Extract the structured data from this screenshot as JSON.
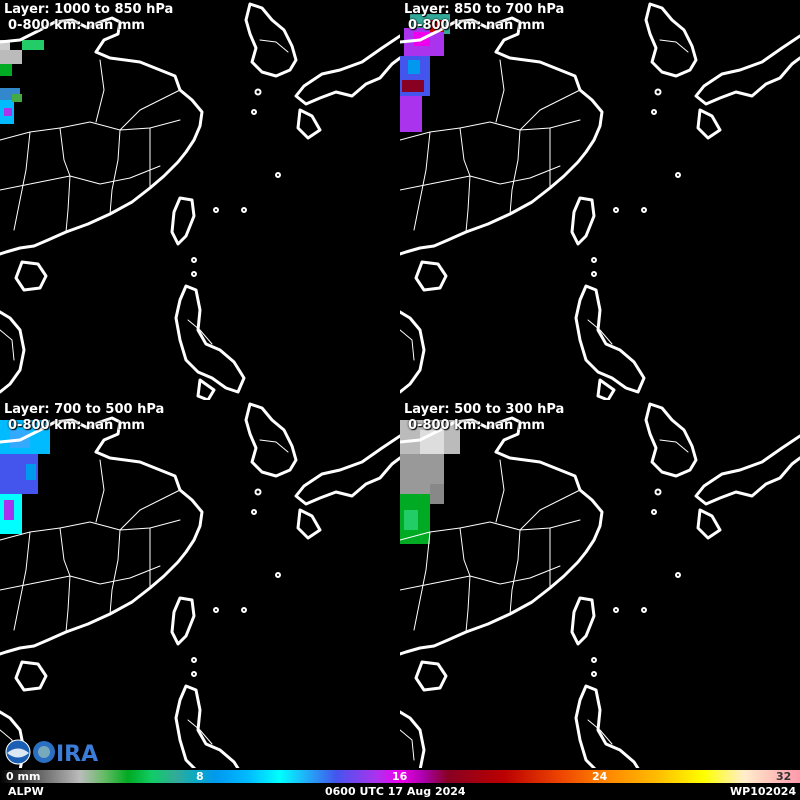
{
  "panels": [
    {
      "layer": "Layer: 1000 to 850 hPa",
      "range": "0-800 km: nan mm"
    },
    {
      "layer": "Layer: 850 to 700 hPa",
      "range": "0-800 km: nan mm"
    },
    {
      "layer": "Layer: 700 to 500 hPa",
      "range": "0-800 km: nan mm"
    },
    {
      "layer": "Layer: 500 to 300 hPa",
      "range": "0-800 km: nan mm"
    }
  ],
  "colorbar": {
    "ticks": [
      "0 mm",
      "8",
      "16",
      "24",
      "32"
    ]
  },
  "footer": {
    "product": "ALPW",
    "time": "0600 UTC 17 Aug 2024",
    "storm_id": "WP102024"
  },
  "logo": {
    "agencies": [
      "NOAA",
      "CIRA"
    ]
  },
  "colors": {
    "coastline": "#ffffff",
    "background": "#000000"
  }
}
